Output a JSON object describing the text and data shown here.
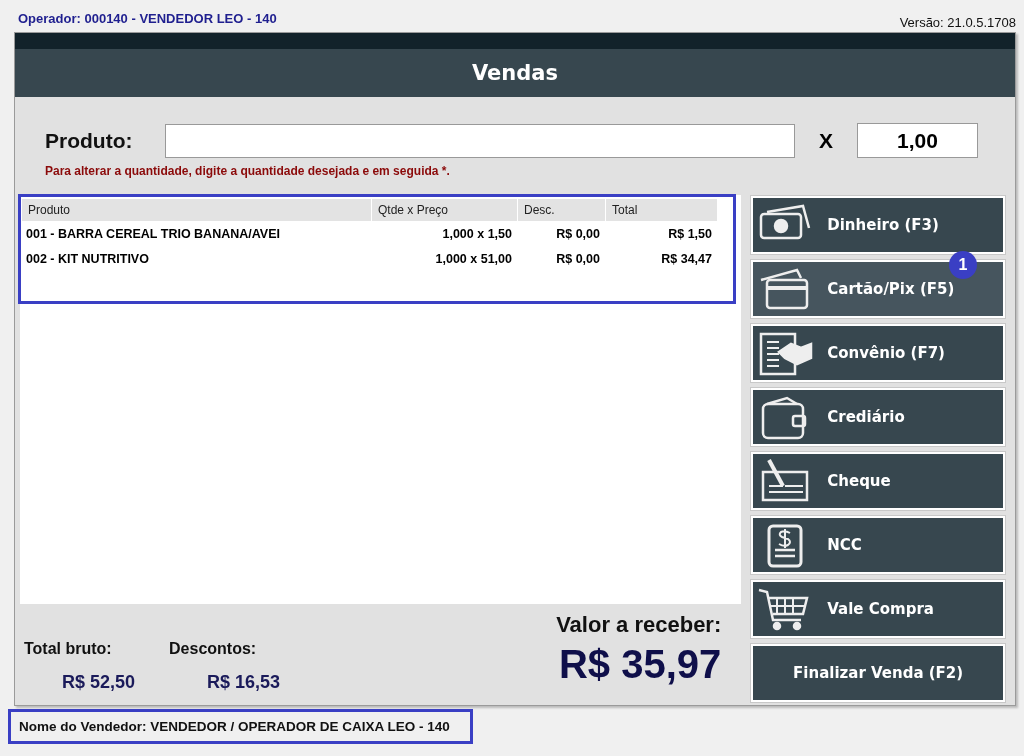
{
  "operator": "Operador: 000140 - VENDEDOR LEO - 140",
  "version": "Versão: 21.0.5.1708",
  "title": "Vendas",
  "product_field": {
    "label": "Produto:"
  },
  "multiply_sign": "X",
  "quantity": "1,00",
  "hint": "Para alterar a quantidade, digite a quantidade desejada e em seguida *.",
  "table": {
    "highlighted": true,
    "columns": [
      "Produto",
      "Qtde x Preço",
      "Desc.",
      "Total"
    ],
    "rows": [
      [
        "001 - BARRA CEREAL TRIO BANANA/AVEI",
        "1,000 x 1,50",
        "R$ 0,00",
        "R$ 1,50"
      ],
      [
        "002 - KIT NUTRITIVO",
        "1,000 x 51,00",
        "R$ 0,00",
        "R$ 34,47"
      ]
    ]
  },
  "payment_buttons": [
    {
      "label": "Dinheiro (F3)",
      "kind": "cash",
      "selected": false
    },
    {
      "label": "Cartão/Pix (F5)",
      "kind": "card",
      "selected": true,
      "badge": "1"
    },
    {
      "label": "Convênio (F7)",
      "kind": "agreement",
      "selected": false
    },
    {
      "label": "Crediário",
      "kind": "wallet",
      "selected": false
    },
    {
      "label": "Cheque",
      "kind": "check",
      "selected": false
    },
    {
      "label": "NCC",
      "kind": "ncc",
      "selected": false
    },
    {
      "label": "Vale Compra",
      "kind": "cart",
      "selected": false
    }
  ],
  "finish_button": "Finalizar Venda (F2)",
  "totals": [
    {
      "label": "Total bruto:",
      "value": "R$ 52,50"
    },
    {
      "label": "Descontos:",
      "value": "R$ 16,53"
    }
  ],
  "amount_due": {
    "label": "Valor a receber:",
    "value": "R$ 35,97"
  },
  "seller": {
    "text": "Nome do Vendedor: VENDEDOR / OPERADOR DE CAIXA LEO - 140",
    "highlighted": true
  }
}
